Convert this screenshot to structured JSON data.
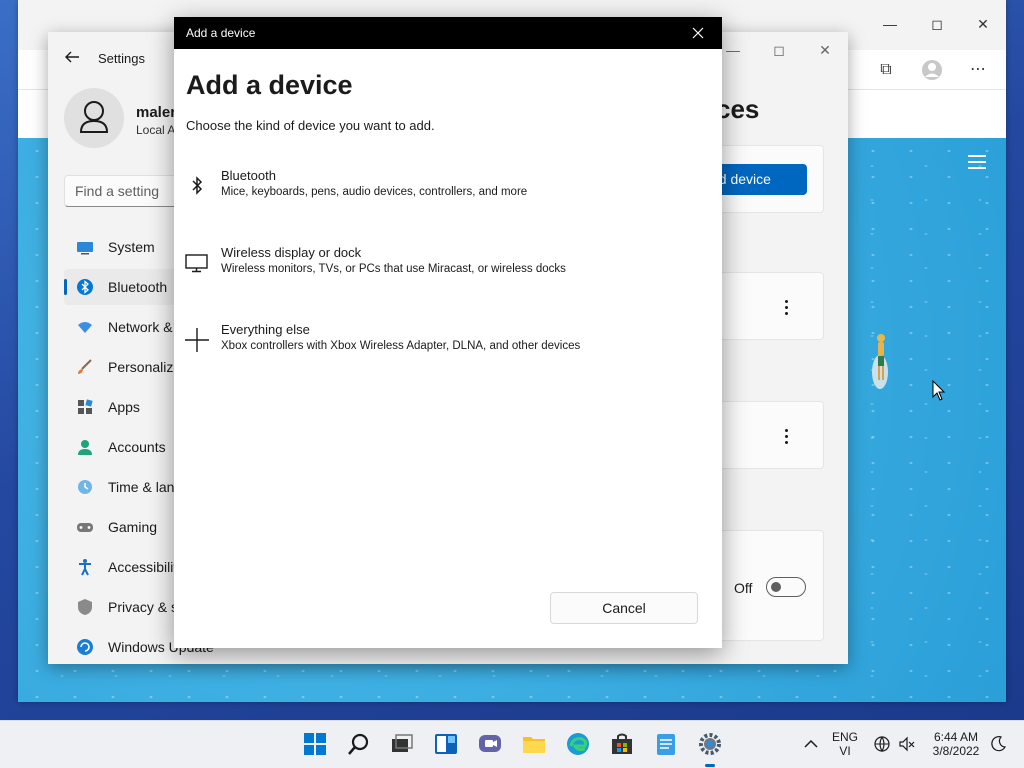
{
  "dialog": {
    "window_title": "Add a device",
    "heading": "Add a device",
    "subtitle": "Choose the kind of device you want to add.",
    "options": [
      {
        "title": "Bluetooth",
        "description": "Mice, keyboards, pens, audio devices, controllers, and more",
        "icon": "bluetooth-icon"
      },
      {
        "title": "Wireless display or dock",
        "description": "Wireless monitors, TVs, or PCs that use Miracast, or wireless docks",
        "icon": "monitor-icon"
      },
      {
        "title": "Everything else",
        "description": "Xbox controllers with Xbox Wireless Adapter, DLNA, and other devices",
        "icon": "plus-icon"
      }
    ],
    "cancel_label": "Cancel"
  },
  "settings": {
    "title": "Settings",
    "profile": {
      "name": "maler",
      "subtitle": "Local A"
    },
    "search_placeholder": "Find a setting",
    "nav": [
      {
        "label": "System",
        "icon": "monitor-icon",
        "selected": false
      },
      {
        "label": "Bluetooth",
        "icon": "bluetooth-icon",
        "selected": true
      },
      {
        "label": "Network &",
        "icon": "wifi-icon",
        "selected": false
      },
      {
        "label": "Personaliza",
        "icon": "brush-icon",
        "selected": false
      },
      {
        "label": "Apps",
        "icon": "apps-icon",
        "selected": false
      },
      {
        "label": "Accounts",
        "icon": "person-icon",
        "selected": false
      },
      {
        "label": "Time & lan",
        "icon": "clock-icon",
        "selected": false
      },
      {
        "label": "Gaming",
        "icon": "controller-icon",
        "selected": false
      },
      {
        "label": "Accessibilit",
        "icon": "accessibility-icon",
        "selected": false
      },
      {
        "label": "Privacy & s",
        "icon": "shield-icon",
        "selected": false
      },
      {
        "label": "Windows Update",
        "icon": "update-icon",
        "selected": false
      }
    ],
    "page_heading": "ces",
    "add_device_label": "dd device",
    "toggle_label": "Off"
  },
  "taskbar": {
    "apps": [
      "windows-start-icon",
      "search-icon",
      "task-view-icon",
      "widgets-icon",
      "teams-chat-icon",
      "file-explorer-icon",
      "edge-icon",
      "store-icon",
      "notepad-icon",
      "settings-icon"
    ],
    "language": "ENG",
    "language_sub": "VI",
    "time": "6:44 AM",
    "date": "3/8/2022"
  },
  "colors": {
    "accent": "#0067c0",
    "dialog_titlebar": "#000000"
  }
}
